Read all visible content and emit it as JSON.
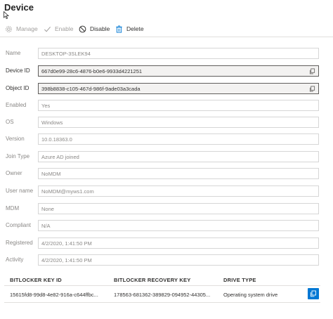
{
  "title": "Device",
  "toolbar": {
    "manage": "Manage",
    "enable": "Enable",
    "disable": "Disable",
    "delete": "Delete"
  },
  "fields": [
    {
      "label": "Name",
      "value": "DESKTOP-3SLEK94"
    },
    {
      "label": "Device ID",
      "value": "667d0e99-28c6-4876-b0e6-9933d4221251"
    },
    {
      "label": "Object ID",
      "value": "398b8838-c105-467d-986f-9ade03a3cada"
    },
    {
      "label": "Enabled",
      "value": "Yes"
    },
    {
      "label": "OS",
      "value": "Windows"
    },
    {
      "label": "Version",
      "value": "10.0.18363.0"
    },
    {
      "label": "Join Type",
      "value": "Azure AD joined"
    },
    {
      "label": "Owner",
      "value": "NoMDM"
    },
    {
      "label": "User name",
      "value": "NoMDM@myws1.com"
    },
    {
      "label": "MDM",
      "value": "None"
    },
    {
      "label": "Compliant",
      "value": "N/A"
    },
    {
      "label": "Registered",
      "value": "4/2/2020, 1:41:50 PM"
    },
    {
      "label": "Activity",
      "value": "4/2/2020, 1:41:50 PM"
    }
  ],
  "bitlocker": {
    "headers": [
      "BITLOCKER KEY ID",
      "BITLOCKER RECOVERY KEY",
      "DRIVE TYPE"
    ],
    "row": [
      "15615fd8-99d8-4e82-916a-c644ffbc...",
      "178563-681362-389829-094952-44305...",
      "Operating system drive"
    ]
  },
  "colors": {
    "accent": "#0078d4",
    "text": "#323130",
    "muted": "#8a8886"
  }
}
